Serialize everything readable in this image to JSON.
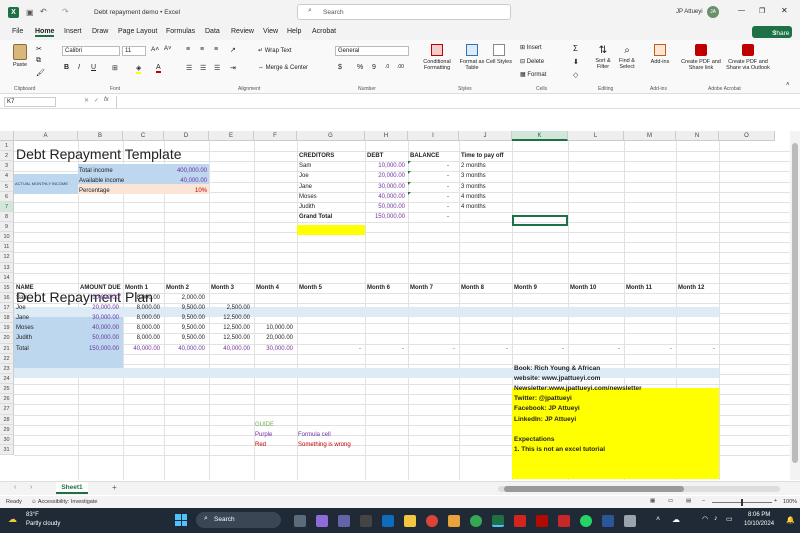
{
  "titlebar": {
    "doc_title": "Debt repayment demo",
    "app": "Excel",
    "search_placeholder": "Search",
    "user": "JP Attueyi",
    "avatar": "JA"
  },
  "tabs": [
    "File",
    "Home",
    "Insert",
    "Draw",
    "Page Layout",
    "Formulas",
    "Data",
    "Review",
    "View",
    "Help",
    "Acrobat"
  ],
  "share_label": "Share",
  "ribbon": {
    "paste": "Paste",
    "clipboard": "Clipboard",
    "font_name": "Calibri",
    "font_size": "11",
    "font": "Font",
    "wrap": "Wrap Text",
    "merge": "Merge & Center",
    "alignment": "Alignment",
    "number_format": "General",
    "number": "Number",
    "cond": "Conditional Formatting",
    "fmt_table": "Format as Table",
    "cell_styles": "Cell Styles",
    "styles": "Styles",
    "insert": "Insert",
    "delete": "Delete",
    "format": "Format",
    "cells": "Cells",
    "sort": "Sort & Filter",
    "find": "Find & Select",
    "editing": "Editing",
    "addin": "Add-ins",
    "addins": "Add-ins",
    "pdf1": "Create PDF and Share link",
    "pdf2": "Create PDF and Share via Outlook",
    "acrobat": "Adobe Acrobat"
  },
  "name_box": "K7",
  "columns": [
    "A",
    "B",
    "C",
    "D",
    "E",
    "F",
    "G",
    "H",
    "I",
    "J",
    "K",
    "L",
    "M",
    "N",
    "O"
  ],
  "rows": [
    "1",
    "2",
    "3",
    "4",
    "5",
    "6",
    "7",
    "8",
    "9",
    "10",
    "11",
    "12",
    "13",
    "14",
    "15",
    "16",
    "17",
    "18",
    "19",
    "20",
    "21",
    "22",
    "23",
    "24",
    "25",
    "26",
    "27",
    "28",
    "29",
    "30",
    "31"
  ],
  "template": {
    "title": "Debt Repayment Template",
    "actual_label": "ACTUAL MONTHLY INCOME",
    "total_income_label": "Total income",
    "total_income": "400,000.00",
    "available_label": "Available income",
    "available": "40,000.00",
    "percentage_label": "Percentage",
    "percentage": "10%"
  },
  "creditors": {
    "headers": [
      "CREDITORS",
      "DEBT",
      "BALANCE",
      "Time to pay off"
    ],
    "rows": [
      [
        "Sam",
        "10,000.00",
        "-",
        "2 months"
      ],
      [
        "Joe",
        "20,000.00",
        "-",
        "3 months"
      ],
      [
        "Jane",
        "30,000.00",
        "-",
        "3 months"
      ],
      [
        "Moses",
        "40,000.00",
        "-",
        "4 months"
      ],
      [
        "Judith",
        "50,000.00",
        "-",
        "4 months"
      ]
    ],
    "total_label": "Grand Total",
    "total": "150,000.00",
    "total_bal": "-"
  },
  "plan": {
    "title": "Debt Repayment Plan",
    "headers": [
      "NAME",
      "AMOUNT DUE",
      "Month 1",
      "Month 2",
      "Month 3",
      "Month 4",
      "Month 5",
      "Month 6",
      "Month 7",
      "Month 8",
      "Month 9",
      "Month 10",
      "Month 11",
      "Month 12"
    ],
    "rows": [
      [
        "Sam",
        "10,000.00",
        "8,000.00",
        "2,000.00",
        "",
        ""
      ],
      [
        "Joe",
        "20,000.00",
        "8,000.00",
        "9,500.00",
        "2,500.00",
        ""
      ],
      [
        "Jane",
        "30,000.00",
        "8,000.00",
        "9,500.00",
        "12,500.00",
        ""
      ],
      [
        "Moses",
        "40,000.00",
        "8,000.00",
        "9,500.00",
        "12,500.00",
        "10,000.00"
      ],
      [
        "Judith",
        "50,000.00",
        "8,000.00",
        "9,500.00",
        "12,500.00",
        "20,000.00"
      ]
    ],
    "total": [
      "Total",
      "150,000.00",
      "40,000.00",
      "40,000.00",
      "40,000.00",
      "30,000.00",
      "-",
      "-",
      "-",
      "-",
      "-",
      "-",
      "-",
      "-"
    ]
  },
  "guide": {
    "title": "GUIDE",
    "purple": "Purple",
    "purple_desc": "Formula cell",
    "red": "Red",
    "red_desc": "Something is wrong"
  },
  "info": [
    "Book: Rich Young & African",
    "website: www.jpattueyi.com",
    "Newsletter:www.jpattueyi.com/newsletter",
    "Twitter: @jpattueyi",
    "Facebook: JP Attueyi",
    "LinkedIn: JP Attueyi",
    "",
    "Expectations",
    "1. This is not an excel tutorial"
  ],
  "sheet_tab": "Sheet1",
  "status": {
    "ready": "Ready",
    "accessibility": "Accessibility: Investigate",
    "zoom": "100%"
  },
  "taskbar": {
    "temp": "83°F",
    "weather": "Partly cloudy",
    "search": "Search",
    "time": "8:06 PM",
    "date": "10/10/2024"
  },
  "colors": {
    "excel_green": "#1e7145",
    "selected_blue": "#bdd7ee",
    "light_blue": "#ddebf7",
    "yellow": "#ffff00",
    "purple": "#7030a0",
    "red": "#c00000",
    "guide_green": "#70ad47"
  }
}
